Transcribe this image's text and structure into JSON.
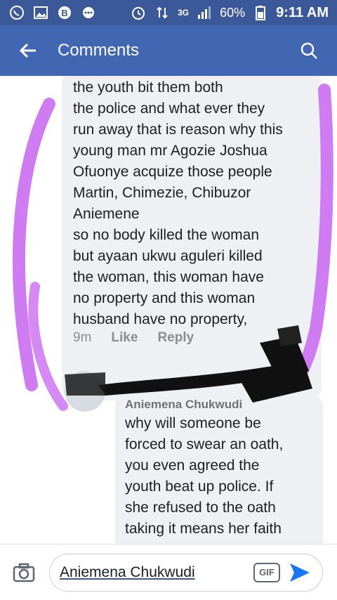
{
  "status_bar": {
    "battery": "60%",
    "time": "9:11 AM",
    "network": "3G"
  },
  "header": {
    "title": "Comments"
  },
  "comment1": {
    "text": "the youth bit them both\nthe police and what ever they\nrun away that is reason why this\nyoung man mr Agozie Joshua\nOfuonye acquize those people\nMartin, Chimezie, Chibuzor\nAniemene\nso no body killed the woman\nbut ayaan ukwu aguleri killed\nthe woman, this woman have\nno property and this woman\nhusband have no property,",
    "time": "9m",
    "like_label": "Like",
    "reply_label": "Reply"
  },
  "reply1": {
    "author": "Aniemena Chukwudi",
    "text": "why will someone be\nforced to swear an oath,\nyou even agreed the\nyouth beat up police.  If\nshe refused to the oath\ntaking it means her faith"
  },
  "input_bar": {
    "text": "Aniemena Chukwudi",
    "gif_label": "GIF"
  },
  "colors": {
    "header_bg": "#4267b2",
    "status_bg": "#3b5998",
    "bubble_bg": "#eef0f4",
    "mark_purple": "#cf7cf2",
    "send_blue": "#1877f2"
  }
}
